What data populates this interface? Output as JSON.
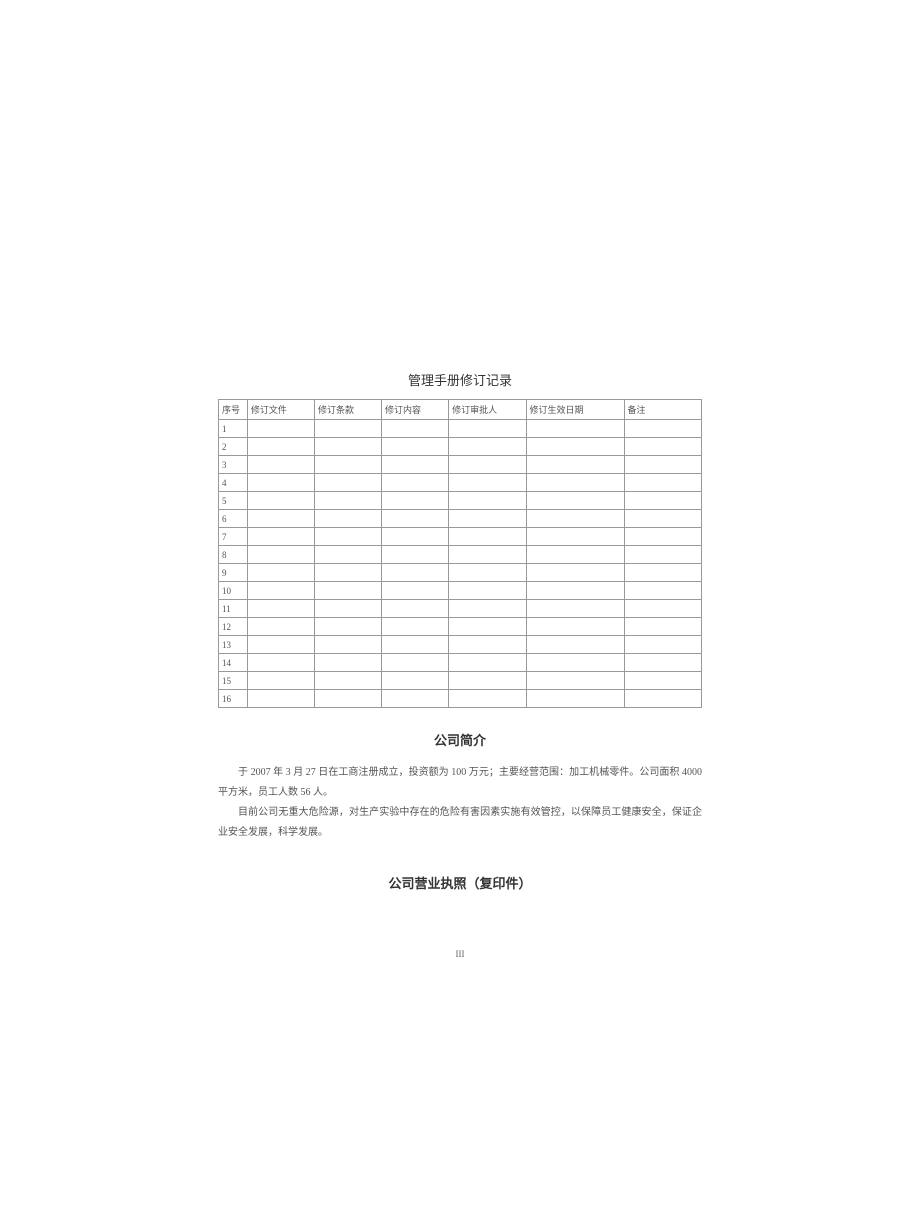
{
  "revisionTable": {
    "title": "管理手册修订记录",
    "headers": {
      "seq": "序号",
      "file": "修订文件",
      "clause": "修订条款",
      "content": "修订内容",
      "approver": "修订审批人",
      "date": "修订生效日期",
      "remark": "备注"
    },
    "rows": [
      "1",
      "2",
      "3",
      "4",
      "5",
      "6",
      "7",
      "8",
      "9",
      "10",
      "11",
      "12",
      "13",
      "14",
      "15",
      "16"
    ]
  },
  "companyIntro": {
    "title": "公司简介",
    "para1": "于 2007 年 3 月 27 日在工商注册成立，投资额为 100 万元；主要经营范围：加工机械零件。公司面积 4000 平方米，员工人数 56 人。",
    "para2": "目前公司无重大危险源，对生产实验中存在的危险有害因素实施有效管控，以保障员工健康安全，保证企业安全发展，科学发展。"
  },
  "licenseTitle": "公司营业执照（复印件）",
  "pageNumber": "III"
}
